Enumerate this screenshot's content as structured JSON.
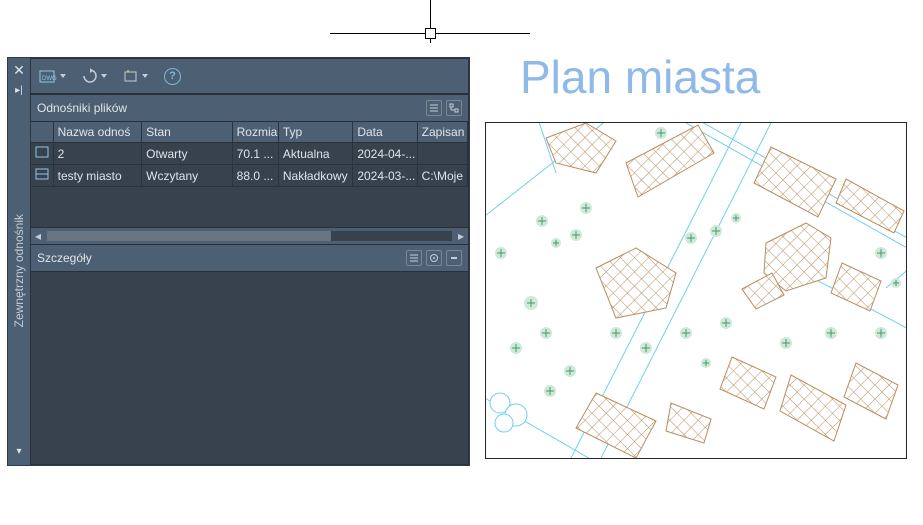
{
  "crosshair": true,
  "title": "Plan miasta",
  "panel": {
    "side_label": "Zewnętrzny odnośnik",
    "references": {
      "header": "Odnośniki plików",
      "columns": [
        "",
        "Nazwa odnoś",
        "Stan",
        "Rozmiar",
        "Typ",
        "Data",
        "Zapisan"
      ],
      "rows": [
        {
          "icon": "dwg-current",
          "name": "2",
          "status": "Otwarty",
          "size": "70.1 ...",
          "type": "Aktualna",
          "date": "2024-04-...",
          "saved": ""
        },
        {
          "icon": "dwg-overlay",
          "name": "testy miasto",
          "status": "Wczytany",
          "size": "88.0 ...",
          "type": "Nakładkowy",
          "date": "2024-03-...",
          "saved": "C:\\Moje"
        }
      ]
    },
    "details": {
      "header": "Szczegóły"
    }
  }
}
